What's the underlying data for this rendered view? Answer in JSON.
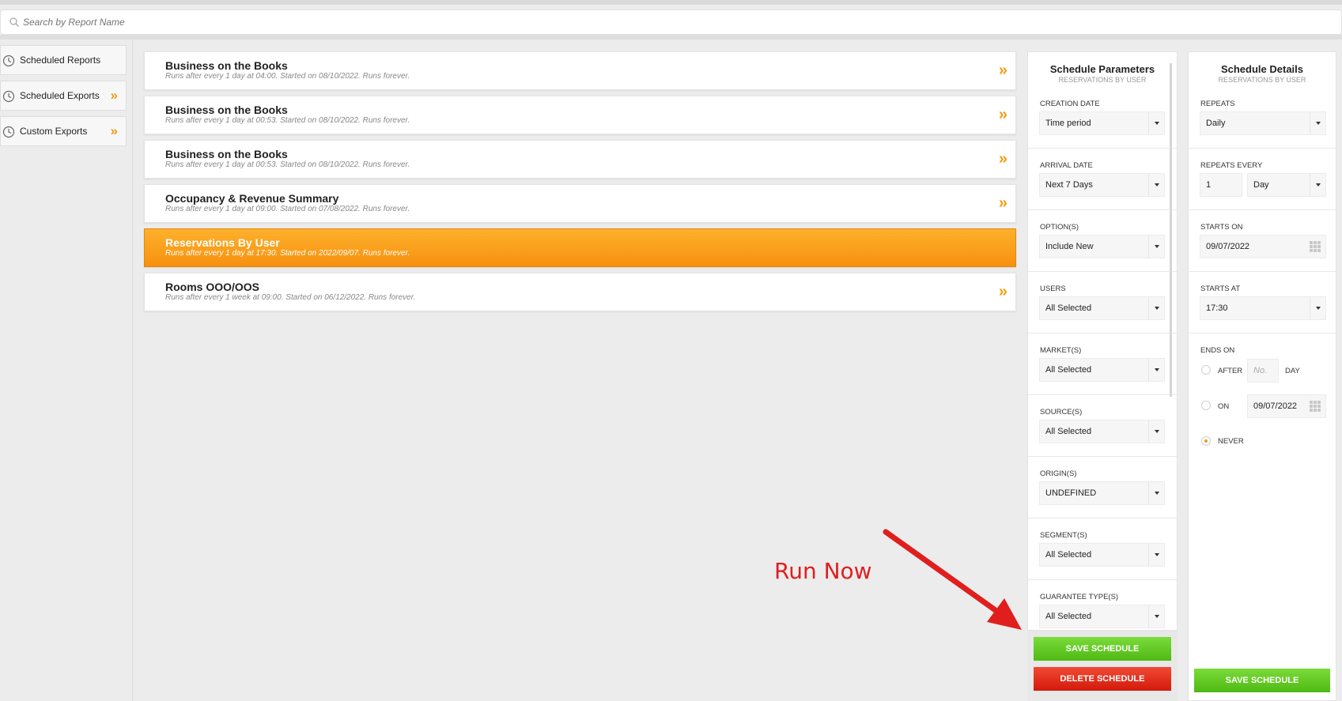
{
  "search": {
    "placeholder": "Search by Report Name"
  },
  "sidebar": {
    "items": [
      {
        "label": "Scheduled Reports",
        "has_chevron": false
      },
      {
        "label": "Scheduled Exports",
        "has_chevron": true
      },
      {
        "label": "Custom Exports",
        "has_chevron": true
      }
    ]
  },
  "reports": [
    {
      "name": "Business on the Books",
      "desc": "Runs after every 1 day at 04:00. Started on 08/10/2022. Runs forever.",
      "chevron": "»"
    },
    {
      "name": "Business on the Books",
      "desc": "Runs after every 1 day at 00:53. Started on 08/10/2022. Runs forever.",
      "chevron": "»"
    },
    {
      "name": "Business on the Books",
      "desc": "Runs after every 1 day at 00:53. Started on 08/10/2022. Runs forever.",
      "chevron": "»"
    },
    {
      "name": "Occupancy & Revenue Summary",
      "desc": "Runs after every 1 day at 09:00. Started on 07/08/2022. Runs forever.",
      "chevron": "»"
    },
    {
      "name": "Reservations By User",
      "desc": "Runs after every 1 day at 17:30. Started on 2022/09/07. Runs forever.",
      "active": true
    },
    {
      "name": "Rooms OOO/OOS",
      "desc": "Runs after every 1 week at 09:00. Started on 06/12/2022. Runs forever.",
      "chevron": "»"
    }
  ],
  "params": {
    "title": "Schedule Parameters",
    "subtitle": "RESERVATIONS BY USER",
    "fields": [
      {
        "label": "CREATION DATE",
        "value": "Time period"
      },
      {
        "label": "ARRIVAL DATE",
        "value": "Next 7 Days"
      },
      {
        "label": "OPTION(S)",
        "value": "Include New"
      },
      {
        "label": "USERS",
        "value": "All Selected"
      },
      {
        "label": "MARKET(S)",
        "value": "All Selected"
      },
      {
        "label": "SOURCE(S)",
        "value": "All Selected"
      },
      {
        "label": "ORIGIN(S)",
        "value": "UNDEFINED"
      },
      {
        "label": "SEGMENT(S)",
        "value": "All Selected"
      },
      {
        "label": "GUARANTEE TYPE(S)",
        "value": "All Selected"
      }
    ],
    "save_label": "SAVE SCHEDULE",
    "delete_label": "DELETE SCHEDULE"
  },
  "details": {
    "title": "Schedule Details",
    "subtitle": "RESERVATIONS BY USER",
    "repeats_label": "REPEATS",
    "repeats_value": "Daily",
    "repeats_every_label": "REPEATS EVERY",
    "repeats_every_number": "1",
    "repeats_every_unit": "Day",
    "starts_on_label": "STARTS ON",
    "starts_on_value": "09/07/2022",
    "starts_at_label": "STARTS AT",
    "starts_at_value": "17:30",
    "ends_on_label": "ENDS ON",
    "after_label": "AFTER",
    "after_placeholder": "No.",
    "day_label": "DAY",
    "on_label": "ON",
    "on_date": "09/07/2022",
    "never_label": "NEVER",
    "ends_selection": "never",
    "save_label": "SAVE SCHEDULE"
  },
  "annotation": {
    "text": "Run Now",
    "color": "#e01e1e"
  },
  "colors": {
    "accent": "#f39c12",
    "save": "#5cc41f",
    "delete": "#e2291a"
  }
}
